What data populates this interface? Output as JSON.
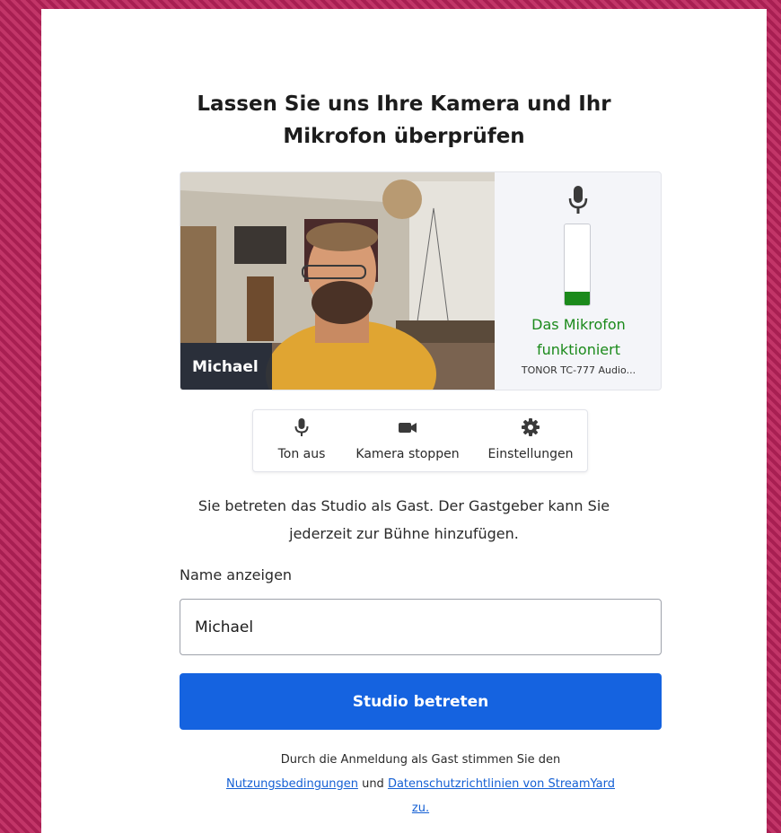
{
  "page": {
    "title_line1": "Lassen Sie uns Ihre Kamera und Ihr",
    "title_line2": "Mikrofon überprüfen"
  },
  "preview": {
    "camera_name": "Michael",
    "mic_status_line1": "Das Mikrofon",
    "mic_status_line2": "funktioniert",
    "mic_device": "TONOR TC-777 Audio...",
    "mic_level": 0.17,
    "status_color": "#1b8a1b"
  },
  "controls": [
    {
      "label": "Ton aus",
      "icon": "microphone-icon"
    },
    {
      "label": "Kamera stoppen",
      "icon": "video-camera-icon"
    },
    {
      "label": "Einstellungen",
      "icon": "gear-icon"
    }
  ],
  "info": {
    "line1": "Sie betreten das Studio als Gast. Der Gastgeber kann Sie",
    "line2": "jederzeit zur Bühne hinzufügen."
  },
  "form": {
    "name_label": "Name anzeigen",
    "name_value": "Michael",
    "submit_label": "Studio betreten",
    "submit_color": "#1563e0"
  },
  "terms": {
    "prefix": "Durch die Anmeldung als Gast stimmen Sie den",
    "link1": "Nutzungsbedingungen",
    "middle": "und",
    "link2": "Datenschutzrichtlinien von StreamYard",
    "link2_end": "zu."
  }
}
